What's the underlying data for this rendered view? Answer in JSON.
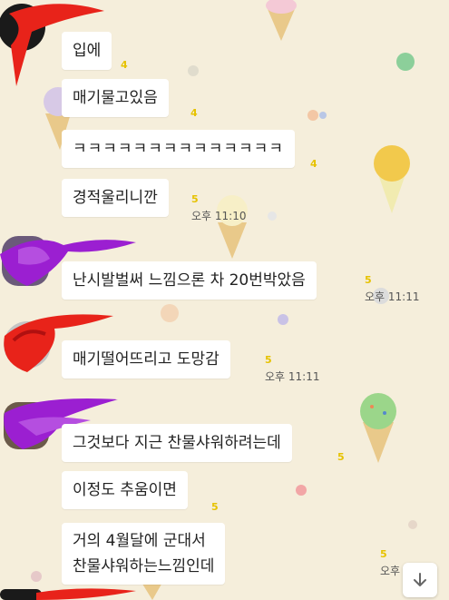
{
  "messages": [
    {
      "text": "입에",
      "count": "4"
    },
    {
      "text": "매기물고있음",
      "count": "4"
    },
    {
      "text": "ㅋㅋㅋㅋㅋㅋㅋㅋㅋㅋㅋㅋㅋㅋ",
      "count": "4"
    },
    {
      "text": "경적울리니깐",
      "count": "5",
      "time": "오후 11:10"
    },
    {
      "text": "난시발벌써 느낌으론 차 20번박았음",
      "count": "5",
      "time": "오후 11:11"
    },
    {
      "text": "매기떨어뜨리고 도망감",
      "count": "5",
      "time": "오후 11:11"
    },
    {
      "text": "그것보다 지근 찬물샤워하려는데",
      "count": "5"
    },
    {
      "text": "이정도 추움이면",
      "count": "5"
    },
    {
      "lines": [
        "거의 4월달에 군대서",
        "찬물샤워하는느낌인데"
      ],
      "count": "5",
      "time": "오후"
    }
  ],
  "icons": {
    "scroll_down": "arrow-down-icon"
  },
  "colors": {
    "background": "#f5eedb",
    "unread_count": "#e6c200",
    "scribble_red": "#e8231a",
    "scribble_purple": "#9b1fd1"
  }
}
